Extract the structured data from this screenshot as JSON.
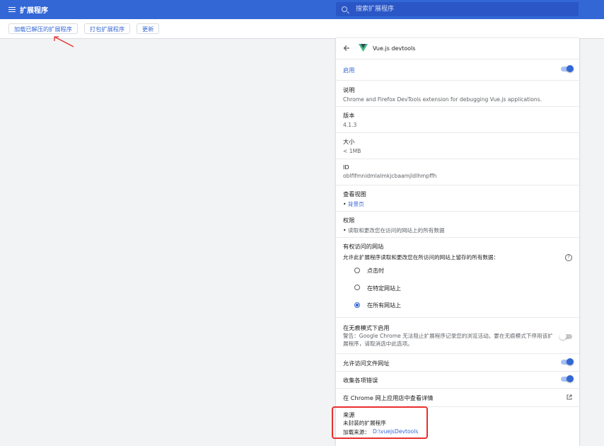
{
  "header": {
    "title": "扩展程序",
    "search_placeholder": "搜索扩展程序"
  },
  "toolbar": {
    "load_unpacked": "加载已解压的扩展程序",
    "pack": "打包扩展程序",
    "update": "更新"
  },
  "detail": {
    "name": "Vue.js devtools",
    "enabled_label": "启用",
    "description_label": "说明",
    "description": "Chrome and Firefox DevTools extension for debugging Vue.js applications.",
    "version_label": "版本",
    "version": "4.1.3",
    "size_label": "大小",
    "size": "< 1MB",
    "id_label": "ID",
    "id": "oblfifmnidmlalmkjcbaamjldlhmpffh",
    "views_label": "查看视图",
    "views": [
      "背景页"
    ],
    "permissions_label": "权限",
    "permissions": [
      "读取和更改您在访问的网站上的所有数据"
    ],
    "site_access_label": "有权访问的网站",
    "site_access_desc": "允许此扩展程序读取和更改您在所访问的网站上留存的所有数据：",
    "site_access_options": [
      "点击时",
      "在特定网站上",
      "在所有网站上"
    ],
    "site_access_selected": "在所有网站上",
    "incognito_label": "在无痕模式下启用",
    "incognito_desc": "警告：Google Chrome 无法阻止扩展程序记录您的浏览活动。要在无痕模式下停用该扩展程序，请取消选中此选项。",
    "file_access_label": "允许访问文件网址",
    "collect_errors_label": "收集各项错误",
    "webstore_label": "在 Chrome 网上应用店中查看详情",
    "source_label": "来源",
    "source_value": "未封装的扩展程序",
    "load_from_label": "加载来源：",
    "load_from_path": "D:\\vuejsDevtools"
  },
  "colors": {
    "brand": "#3367d6",
    "highlight": "#e8302e"
  }
}
